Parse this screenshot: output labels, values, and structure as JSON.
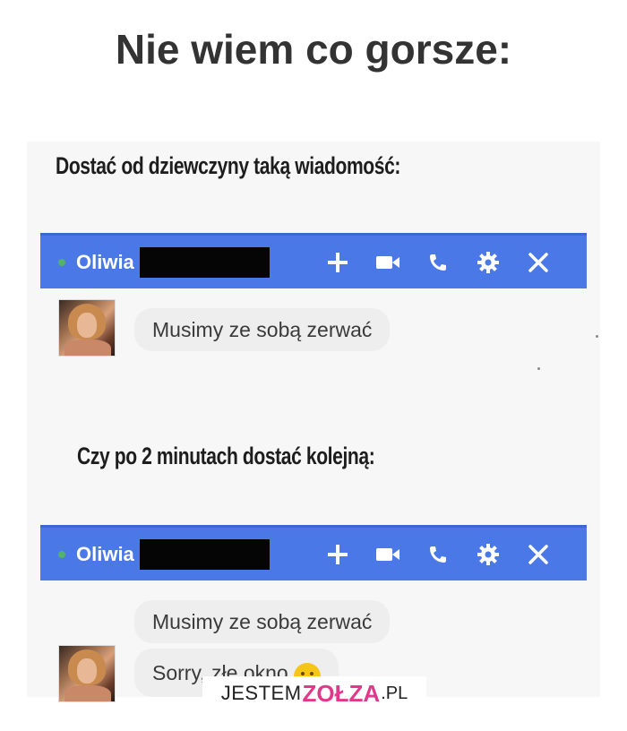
{
  "page_title": "Nie wiem co gorsze:",
  "headings": {
    "first": "Dostać od dziewczyny taką wiadomość:",
    "second": "Czy po 2 minutach dostać kolejną:"
  },
  "chat1": {
    "contact_name": "Oliwia",
    "messages": [
      "Musimy ze sobą zerwać"
    ]
  },
  "chat2": {
    "contact_name": "Oliwia",
    "messages": [
      "Musimy ze sobą zerwać",
      "Sorry, złe okno"
    ]
  },
  "toolbar_icons": [
    "plus-icon",
    "video-camera-icon",
    "phone-icon",
    "gear-icon",
    "close-icon"
  ],
  "colors": {
    "chat_bar": "#4a78e6",
    "online_dot": "#52b36a",
    "bubble": "#eeeeef",
    "watermark_accent": "#e0398a"
  },
  "watermark": {
    "part1": "JESTEM",
    "part2": "ZOŁZA",
    "part3": ".PL"
  }
}
